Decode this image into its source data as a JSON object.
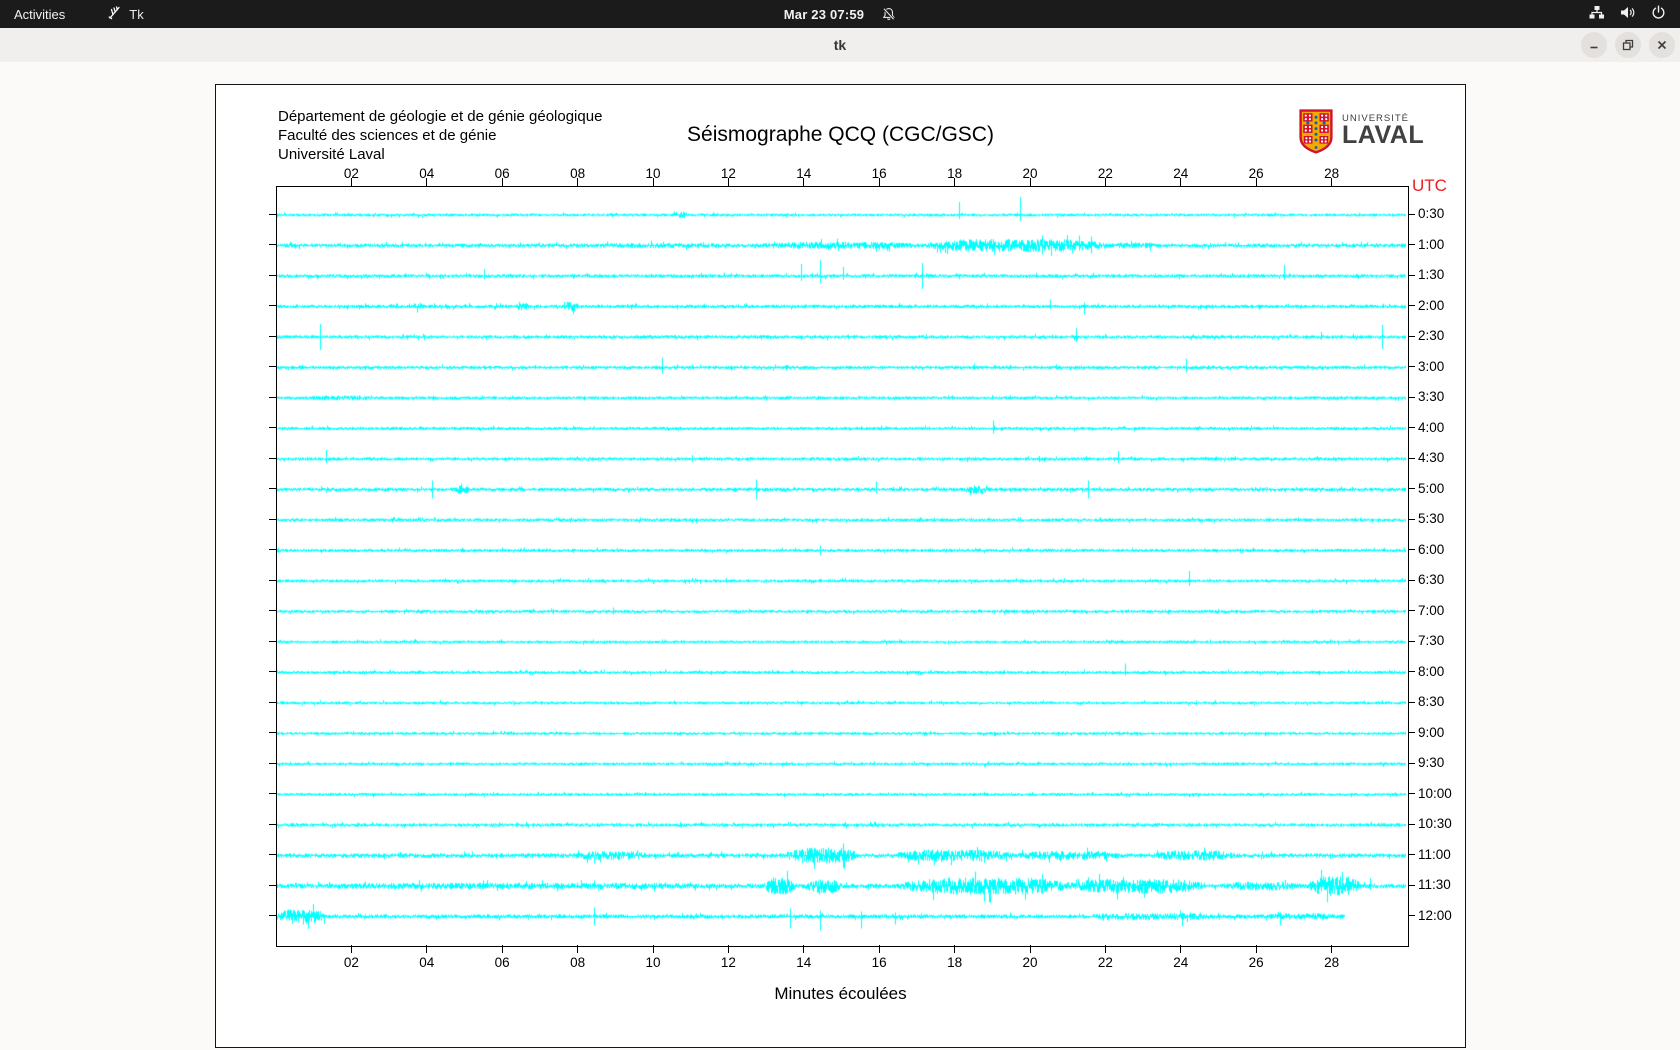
{
  "topbar": {
    "activities_label": "Activities",
    "app_name": "Tk",
    "clock": "Mar 23 07:59"
  },
  "window": {
    "title": "tk"
  },
  "canvas": {
    "address_lines": [
      "Département de géologie et de génie géologique",
      "Faculté des sciences et de génie",
      "Université Laval"
    ],
    "title": "Séismographe QCQ (CGC/GSC)",
    "logo": {
      "small": "UNIVERSITÉ",
      "large": "LAVAL"
    },
    "utc_label": "UTC",
    "xlabel": "Minutes écoulées",
    "trace_color": "#00ffff",
    "utc_color": "#ee1c25"
  },
  "chart_data": {
    "type": "line",
    "subtype": "seismogram-helicorder",
    "title": "Séismographe QCQ (CGC/GSC)",
    "xlabel": "Minutes écoulées",
    "right_axis_label": "UTC",
    "x_range_minutes": [
      0,
      30
    ],
    "x_ticks": [
      "02",
      "04",
      "06",
      "08",
      "10",
      "12",
      "14",
      "16",
      "18",
      "20",
      "22",
      "24",
      "26",
      "28"
    ],
    "rows": [
      {
        "label": "0:30",
        "base": 1.5,
        "events": [
          {
            "type": "burst",
            "from": 10.5,
            "to": 10.9,
            "amp": 3.5
          },
          {
            "type": "spike",
            "at": 18.1,
            "up": 13,
            "down": 4
          },
          {
            "type": "spike",
            "at": 19.7,
            "up": 18,
            "down": 6
          }
        ]
      },
      {
        "label": "1:00",
        "base": 2.0,
        "events": [
          {
            "type": "burst",
            "from": 8.0,
            "to": 12.6,
            "amp": 2.6
          },
          {
            "type": "burst",
            "from": 12.6,
            "to": 17.2,
            "amp": 3.6
          },
          {
            "type": "burst",
            "from": 17.2,
            "to": 22.0,
            "amp": 6.5
          },
          {
            "type": "burst",
            "from": 22.0,
            "to": 23.5,
            "amp": 3.0
          },
          {
            "type": "spike",
            "at": 20.3,
            "up": 10,
            "down": 9
          },
          {
            "type": "spike",
            "at": 21.6,
            "up": 9,
            "down": 8
          }
        ]
      },
      {
        "label": "1:30",
        "base": 1.8,
        "events": [
          {
            "type": "spike",
            "at": 5.5,
            "up": 7,
            "down": 3
          },
          {
            "type": "spike",
            "at": 13.9,
            "up": 12,
            "down": 5
          },
          {
            "type": "spike",
            "at": 14.4,
            "up": 16,
            "down": 7
          },
          {
            "type": "spike",
            "at": 15.0,
            "up": 9,
            "down": 4
          },
          {
            "type": "spike",
            "at": 17.1,
            "up": 13,
            "down": 13
          },
          {
            "type": "spike",
            "at": 26.7,
            "up": 11,
            "down": 4
          }
        ]
      },
      {
        "label": "2:00",
        "base": 1.8,
        "events": [
          {
            "type": "burst",
            "from": 3.6,
            "to": 3.9,
            "amp": 4.5
          },
          {
            "type": "burst",
            "from": 6.3,
            "to": 6.7,
            "amp": 3.5
          },
          {
            "type": "burst",
            "from": 7.6,
            "to": 8.0,
            "amp": 5.0
          },
          {
            "type": "spike",
            "at": 20.5,
            "up": 7,
            "down": 3
          },
          {
            "type": "spike",
            "at": 21.4,
            "up": 4,
            "down": 8
          }
        ]
      },
      {
        "label": "2:30",
        "base": 1.8,
        "events": [
          {
            "type": "spike",
            "at": 1.15,
            "up": 13,
            "down": 13
          },
          {
            "type": "spike",
            "at": 21.2,
            "up": 9,
            "down": 5
          },
          {
            "type": "spike",
            "at": 27.7,
            "up": 5,
            "down": 3
          },
          {
            "type": "spike",
            "at": 29.3,
            "up": 12,
            "down": 12
          }
        ]
      },
      {
        "label": "3:00",
        "base": 1.7,
        "events": [
          {
            "type": "spike",
            "at": 10.2,
            "up": 10,
            "down": 6
          },
          {
            "type": "spike",
            "at": 18.5,
            "up": 4,
            "down": 2
          },
          {
            "type": "spike",
            "at": 24.1,
            "up": 9,
            "down": 5
          }
        ]
      },
      {
        "label": "3:30",
        "base": 1.6,
        "events": [
          {
            "type": "burst",
            "from": 0.6,
            "to": 2.6,
            "amp": 2.4
          }
        ]
      },
      {
        "label": "4:00",
        "base": 1.6,
        "events": [
          {
            "type": "spike",
            "at": 19.0,
            "up": 8,
            "down": 5
          }
        ]
      },
      {
        "label": "4:30",
        "base": 1.7,
        "events": [
          {
            "type": "spike",
            "at": 1.3,
            "up": 9,
            "down": 4
          },
          {
            "type": "spike",
            "at": 11.0,
            "up": 4,
            "down": 3
          },
          {
            "type": "spike",
            "at": 22.3,
            "up": 8,
            "down": 4
          }
        ]
      },
      {
        "label": "5:00",
        "base": 1.8,
        "events": [
          {
            "type": "spike",
            "at": 4.1,
            "up": 9,
            "down": 9
          },
          {
            "type": "burst",
            "from": 4.7,
            "to": 5.1,
            "amp": 4.0
          },
          {
            "type": "spike",
            "at": 12.7,
            "up": 10,
            "down": 10
          },
          {
            "type": "spike",
            "at": 15.9,
            "up": 8,
            "down": 4
          },
          {
            "type": "burst",
            "from": 18.3,
            "to": 18.9,
            "amp": 5.0
          },
          {
            "type": "spike",
            "at": 21.5,
            "up": 9,
            "down": 9
          }
        ]
      },
      {
        "label": "5:30",
        "base": 1.6,
        "events": []
      },
      {
        "label": "6:00",
        "base": 1.6,
        "events": [
          {
            "type": "spike",
            "at": 14.4,
            "up": 5,
            "down": 5
          }
        ]
      },
      {
        "label": "6:30",
        "base": 1.6,
        "events": [
          {
            "type": "spike",
            "at": 24.2,
            "up": 10,
            "down": 5
          }
        ]
      },
      {
        "label": "7:00",
        "base": 1.6,
        "events": [
          {
            "type": "spike",
            "at": 8.9,
            "up": 4,
            "down": 3
          }
        ]
      },
      {
        "label": "7:30",
        "base": 1.5,
        "events": []
      },
      {
        "label": "8:00",
        "base": 1.6,
        "events": [
          {
            "type": "spike",
            "at": 22.5,
            "up": 9,
            "down": 3
          }
        ]
      },
      {
        "label": "8:30",
        "base": 1.5,
        "events": []
      },
      {
        "label": "9:00",
        "base": 1.5,
        "events": []
      },
      {
        "label": "9:30",
        "base": 1.5,
        "events": []
      },
      {
        "label": "10:00",
        "base": 1.5,
        "events": []
      },
      {
        "label": "10:30",
        "base": 1.8,
        "events": []
      },
      {
        "label": "11:00",
        "base": 2.2,
        "events": [
          {
            "type": "burst",
            "from": 7.8,
            "to": 9.9,
            "amp": 4.5
          },
          {
            "type": "burst",
            "from": 13.5,
            "to": 15.4,
            "amp": 8.0
          },
          {
            "type": "burst",
            "from": 16.4,
            "to": 19.5,
            "amp": 6.0
          },
          {
            "type": "burst",
            "from": 19.5,
            "to": 22.5,
            "amp": 4.5
          },
          {
            "type": "burst",
            "from": 23.2,
            "to": 25.5,
            "amp": 5.0
          },
          {
            "type": "spike",
            "at": 15.0,
            "up": 12,
            "down": 12
          },
          {
            "type": "spike",
            "at": 24.6,
            "up": 8,
            "down": 5
          }
        ]
      },
      {
        "label": "11:30",
        "base": 2.4,
        "events": [
          {
            "type": "burst",
            "from": 0.0,
            "to": 13.0,
            "amp": 3.2
          },
          {
            "type": "burst",
            "from": 12.9,
            "to": 13.7,
            "amp": 9.0
          },
          {
            "type": "burst",
            "from": 14.0,
            "to": 15.0,
            "amp": 7.0
          },
          {
            "type": "burst",
            "from": 16.6,
            "to": 21.0,
            "amp": 8.5
          },
          {
            "type": "burst",
            "from": 21.0,
            "to": 24.6,
            "amp": 7.5
          },
          {
            "type": "burst",
            "from": 25.0,
            "to": 27.2,
            "amp": 4.5
          },
          {
            "type": "burst",
            "from": 27.4,
            "to": 28.7,
            "amp": 10.0
          },
          {
            "type": "spike",
            "at": 17.4,
            "up": 6,
            "down": 14
          },
          {
            "type": "spike",
            "at": 18.9,
            "up": 6,
            "down": 17
          },
          {
            "type": "spike",
            "at": 20.3,
            "up": 12,
            "down": 8
          },
          {
            "type": "spike",
            "at": 23.0,
            "up": 5,
            "down": 12
          },
          {
            "type": "spike",
            "at": 29.0,
            "up": 8,
            "down": 4
          }
        ]
      },
      {
        "label": "12:00",
        "base": 2.1,
        "end": 28.3,
        "events": [
          {
            "type": "burst",
            "from": 0.0,
            "to": 1.3,
            "amp": 7.5
          },
          {
            "type": "spike",
            "at": 8.4,
            "up": 9,
            "down": 9
          },
          {
            "type": "spike",
            "at": 13.6,
            "up": 8,
            "down": 12
          },
          {
            "type": "spike",
            "at": 14.4,
            "up": 6,
            "down": 14
          },
          {
            "type": "spike",
            "at": 15.5,
            "up": 5,
            "down": 12
          },
          {
            "type": "spike",
            "at": 16.4,
            "up": 4,
            "down": 8
          },
          {
            "type": "burst",
            "from": 21.3,
            "to": 25.2,
            "amp": 3.5
          },
          {
            "type": "burst",
            "from": 26.0,
            "to": 28.3,
            "amp": 3.0
          },
          {
            "type": "spike",
            "at": 24.0,
            "up": 4,
            "down": 10
          },
          {
            "type": "spike",
            "at": 26.6,
            "up": 4,
            "down": 9
          }
        ]
      }
    ]
  }
}
